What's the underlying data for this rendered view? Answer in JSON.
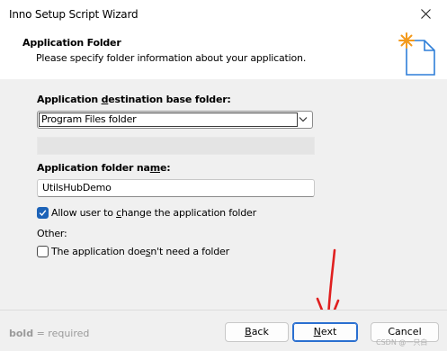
{
  "window": {
    "title": "Inno Setup Script Wizard"
  },
  "header": {
    "title": "Application Folder",
    "description": "Please specify folder information about your application."
  },
  "form": {
    "base_folder_label": {
      "pre": "Application ",
      "u": "d",
      "post": "estination base folder:"
    },
    "base_folder_value": "Program Files folder",
    "folder_name_label": {
      "pre": "Application folder na",
      "u": "m",
      "post": "e:"
    },
    "folder_name_value": "UtilsHubDemo",
    "allow_change": {
      "pre": "Allow user to ",
      "u": "c",
      "post": "hange the application folder",
      "checked": true
    },
    "other_label": "Other:",
    "no_folder": {
      "pre": "The application doe",
      "u": "s",
      "post": "n't need a folder",
      "checked": false
    }
  },
  "footer": {
    "hint_bold": "bold",
    "hint_rest": " = required",
    "back": {
      "u": "B",
      "post": "ack"
    },
    "next": {
      "u": "N",
      "post": "ext"
    },
    "cancel": "Cancel"
  },
  "watermark": "CSDN @一只白",
  "annotation": {
    "color": "#e02020"
  }
}
